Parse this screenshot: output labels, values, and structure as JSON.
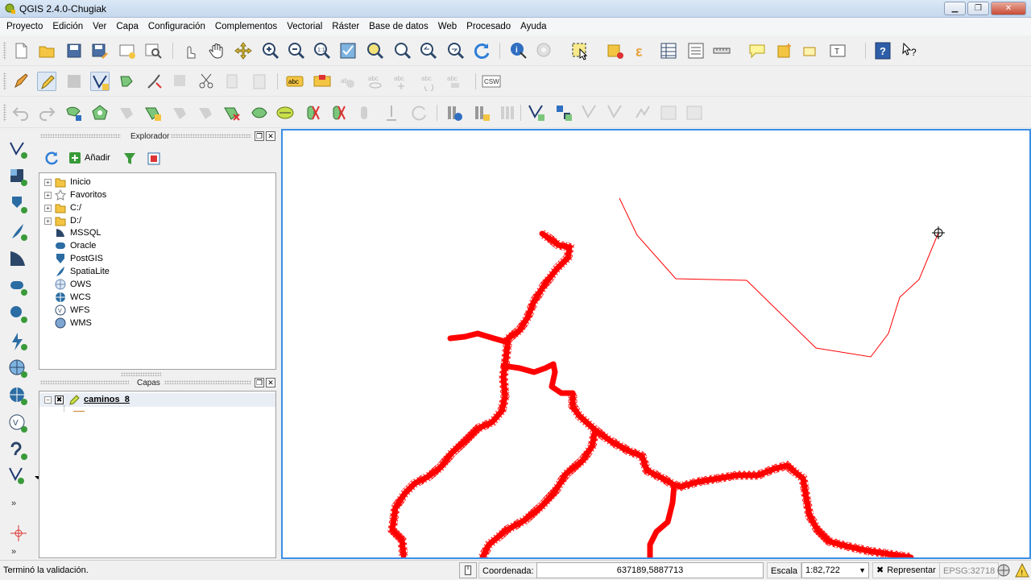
{
  "window": {
    "title": "QGIS 2.4.0-Chugiak",
    "minimize": "▁",
    "maximize": "❐",
    "close": "✕"
  },
  "menu": [
    "Proyecto",
    "Edición",
    "Ver",
    "Capa",
    "Configuración",
    "Complementos",
    "Vectorial",
    "Ráster",
    "Base de datos",
    "Web",
    "Procesado",
    "Ayuda"
  ],
  "toolbar1": [
    "new-project-icon",
    "open-project-icon",
    "save-project-icon",
    "save-as-icon",
    "new-print-composer-icon",
    "composer-manager-icon",
    "touch-zoom-icon",
    "pan-icon",
    "pan-to-selection-icon",
    "zoom-in-icon",
    "zoom-out-icon",
    "zoom-actual-size-icon",
    "zoom-full-icon",
    "zoom-to-selection-icon",
    "zoom-to-layer-icon",
    "zoom-last-icon",
    "zoom-next-icon",
    "refresh-icon",
    "identify-icon",
    "run-action-icon",
    "select-features-icon",
    "deselect-icon",
    "field-calculator-icon",
    "attribute-table-icon",
    "statistics-icon",
    "measure-icon",
    "map-tips-icon",
    "new-bookmark-icon",
    "show-bookmarks-icon",
    "text-annotation-icon",
    "help-icon",
    "whats-this-icon"
  ],
  "toolbar2": [
    "current-edits-icon",
    "toggle-editing-icon",
    "save-edits-icon",
    "add-feature-icon",
    "move-feature-icon",
    "node-tool-icon",
    "delete-selected-icon",
    "cut-features-icon",
    "copy-features-icon",
    "paste-features-icon",
    "label-icon",
    "label-pin-icon",
    "label-highlight-icon",
    "label-show-hide-icon",
    "label-move-icon",
    "label-rotate-icon",
    "label-change-icon",
    "csw-icon"
  ],
  "toolbar3": [
    "undo-icon",
    "redo-icon",
    "simplify-feature-icon",
    "add-ring-icon",
    "add-part-icon",
    "fill-ring-icon",
    "delete-ring-icon",
    "delete-part-icon",
    "reshape-features-icon",
    "offset-curve-icon",
    "split-features-icon",
    "split-parts-icon",
    "merge-selected-icon",
    "merge-attributes-icon",
    "rotate-point-icon",
    "db-manager-icon",
    "spatialite-manager-icon",
    "grass-icon",
    "grass-tools-icon",
    "georeferencer-icon",
    "heatmap-icon",
    "interpolation-icon",
    "road-graph-icon",
    "topology-checker-icon",
    "sql-layer-icon",
    "oracle-georaster-icon"
  ],
  "browser": {
    "title": "Explorador",
    "add_label": "Añadir",
    "items": [
      {
        "label": "Inicio",
        "expandable": true,
        "icon": "folder-icon"
      },
      {
        "label": "Favoritos",
        "expandable": true,
        "icon": "star-icon"
      },
      {
        "label": "C:/",
        "expandable": true,
        "icon": "folder-icon"
      },
      {
        "label": "D:/",
        "expandable": true,
        "icon": "folder-icon"
      },
      {
        "label": "MSSQL",
        "expandable": false,
        "icon": "mssql-icon"
      },
      {
        "label": "Oracle",
        "expandable": false,
        "icon": "oracle-icon"
      },
      {
        "label": "PostGIS",
        "expandable": false,
        "icon": "postgis-icon"
      },
      {
        "label": "SpatiaLite",
        "expandable": false,
        "icon": "spatialite-icon"
      },
      {
        "label": "OWS",
        "expandable": false,
        "icon": "globe-icon"
      },
      {
        "label": "WCS",
        "expandable": false,
        "icon": "wcs-icon"
      },
      {
        "label": "WFS",
        "expandable": false,
        "icon": "wfs-icon"
      },
      {
        "label": "WMS",
        "expandable": false,
        "icon": "wms-icon"
      }
    ]
  },
  "layers": {
    "title": "Capas",
    "items": [
      {
        "name": "caminos_8",
        "visible": true,
        "editing": true
      }
    ]
  },
  "status": {
    "message": "Terminó la validación.",
    "coordinate_label": "Coordenada:",
    "coordinate_value": "637189,5887713",
    "scale_label": "Escala",
    "scale_value": "1:82,722",
    "render_label": "Representar",
    "crs": "EPSG:32718"
  },
  "colors": {
    "feature_stroke": "#ff0000",
    "map_border": "#3a8ee6",
    "titlebar": "#c6d8ee"
  }
}
